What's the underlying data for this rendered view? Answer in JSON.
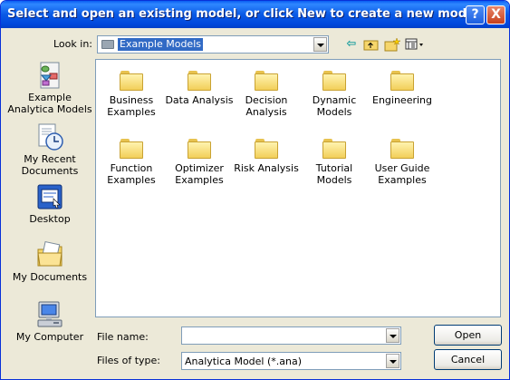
{
  "window": {
    "title": "Select and open an existing model, or click New to create a new model",
    "help_label": "?",
    "close_label": "X"
  },
  "lookin": {
    "label": "Look in:",
    "value": "Example Models"
  },
  "toolbar": {
    "back_icon": "back-arrow-icon",
    "up_icon": "up-folder-icon",
    "new_folder_icon": "new-folder-icon",
    "view_icon": "view-menu-icon"
  },
  "places": [
    {
      "label": "Example Analytica Models",
      "icon": "analytica-models-icon"
    },
    {
      "label": "My Recent Documents",
      "icon": "recent-documents-icon"
    },
    {
      "label": "Desktop",
      "icon": "desktop-icon"
    },
    {
      "label": "My Documents",
      "icon": "my-documents-icon"
    },
    {
      "label": "My Computer",
      "icon": "my-computer-icon"
    }
  ],
  "folders": [
    {
      "label": "Business Examples"
    },
    {
      "label": "Data Analysis"
    },
    {
      "label": "Decision Analysis"
    },
    {
      "label": "Dynamic Models"
    },
    {
      "label": "Engineering"
    },
    {
      "label": "Function Examples"
    },
    {
      "label": "Optimizer Examples"
    },
    {
      "label": "Risk Analysis"
    },
    {
      "label": "Tutorial Models"
    },
    {
      "label": "User Guide Examples"
    }
  ],
  "file_name": {
    "label": "File name:",
    "value": ""
  },
  "file_type": {
    "label": "Files of type:",
    "value": "Analytica Model (*.ana)"
  },
  "buttons": {
    "open": "Open",
    "cancel": "Cancel"
  }
}
